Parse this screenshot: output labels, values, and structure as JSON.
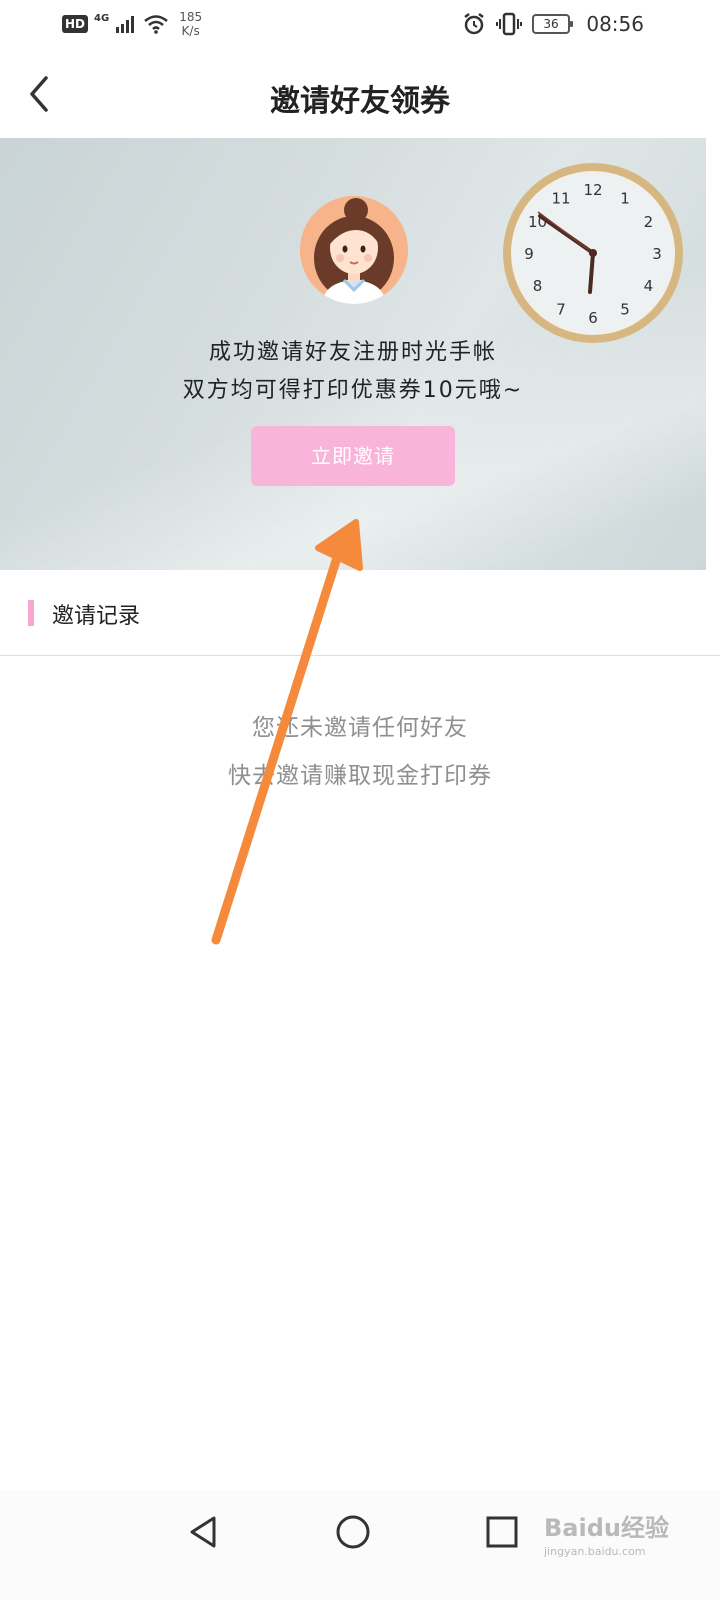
{
  "status_bar": {
    "hd": "HD",
    "network": "4G",
    "speed_value": "185",
    "speed_unit": "K/s",
    "battery": "36",
    "time": "08:56"
  },
  "nav": {
    "title": "邀请好友领券"
  },
  "banner": {
    "line1": "成功邀请好友注册时光手帐",
    "line2": "双方均可得打印优惠券10元哦~",
    "invite_button": "立即邀请",
    "clock_numbers": [
      "12",
      "1",
      "2",
      "3",
      "4",
      "5",
      "6",
      "7",
      "8",
      "9",
      "10",
      "11"
    ]
  },
  "records": {
    "title": "邀请记录",
    "empty_line1": "您还未邀请任何好友",
    "empty_line2": "快去邀请赚取现金打印券"
  },
  "watermark": {
    "text": "Baidu经验",
    "url": "jingyan.baidu.com"
  },
  "colors": {
    "accent_pink": "#f9b4d9",
    "record_bar": "#f6a6cf",
    "arrow": "#f58a3c"
  }
}
